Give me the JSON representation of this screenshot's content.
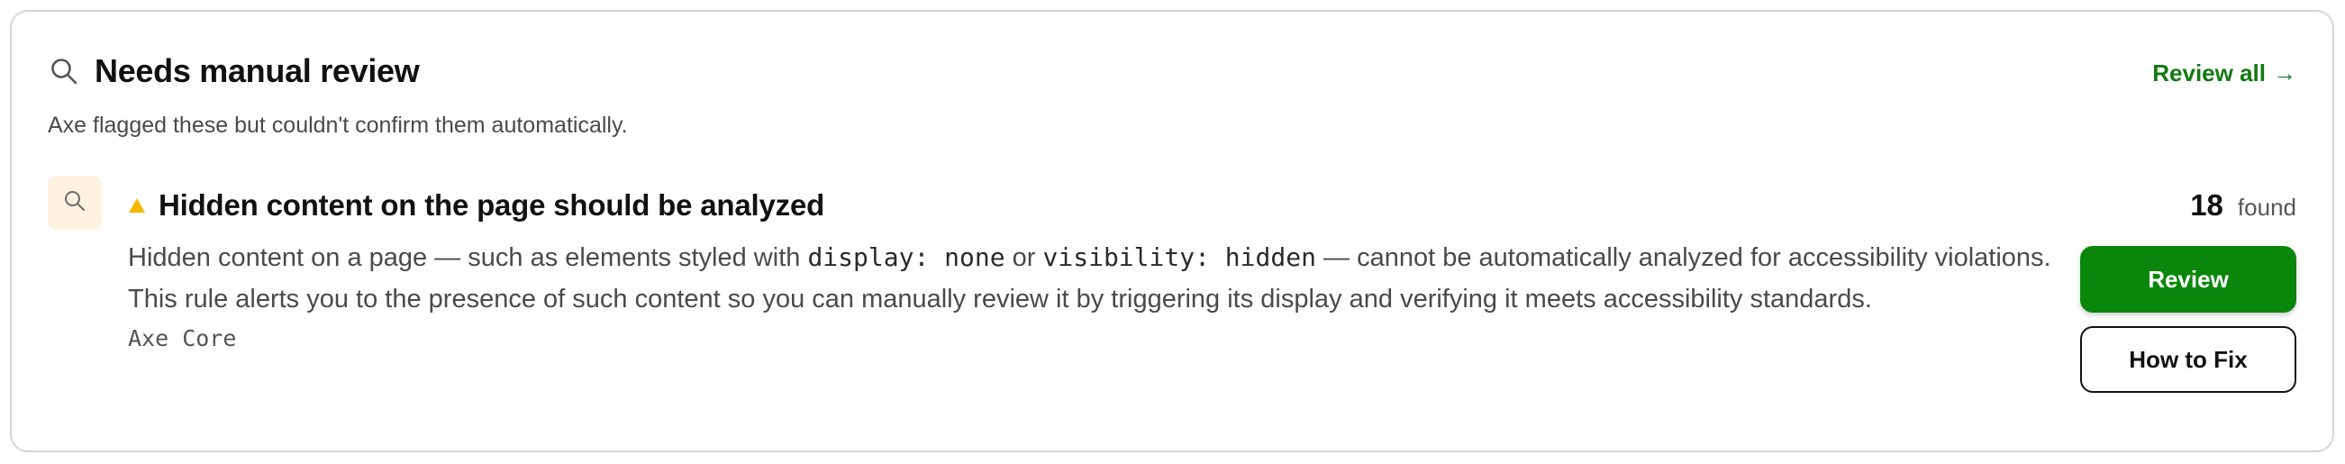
{
  "section": {
    "icon": "search-icon",
    "title": "Needs manual review",
    "subtitle": "Axe flagged these but couldn't confirm them automatically.",
    "review_all_label": "Review all",
    "review_all_arrow": "→"
  },
  "rule": {
    "icon": "search-icon",
    "severity_icon": "warning-triangle-icon",
    "title": "Hidden content on the page should be analyzed",
    "description": {
      "part1": "Hidden content on a page — such as elements styled with ",
      "code1": "display: none",
      "part2": " or ",
      "code2": "visibility: hidden",
      "part3": " — cannot be automatically analyzed for accessibility violations. This rule alerts you to the presence of such content so you can manually review it by triggering its display and verifying it meets accessibility standards."
    },
    "source": "Axe Core",
    "count": "18",
    "count_label": "found",
    "review_button": "Review",
    "how_to_fix_button": "How to Fix"
  },
  "colors": {
    "accent_green": "#0a870a",
    "link_green": "#117a11",
    "warning_yellow": "#f5b800",
    "icon_box_bg": "#fdf2e1"
  }
}
